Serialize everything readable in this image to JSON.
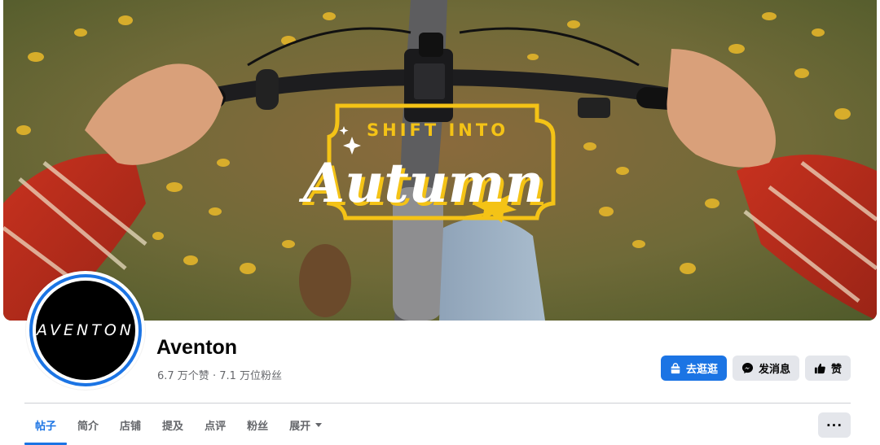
{
  "cover": {
    "kicker": "SHIFT INTO",
    "headline": "Autumn",
    "frame_color": "#f4c316"
  },
  "avatar": {
    "logo_text": "AVENTON",
    "ring_color": "#1b74e4"
  },
  "page": {
    "name": "Aventon",
    "stats": "6.7 万个赞 · 7.1 万位粉丝"
  },
  "actions": {
    "shop": {
      "label": "去逛逛",
      "icon": "shop-bag-icon"
    },
    "message": {
      "label": "发消息",
      "icon": "messenger-icon"
    },
    "like": {
      "label": "赞",
      "icon": "thumbs-up-icon"
    }
  },
  "tabs": [
    {
      "label": "帖子",
      "active": true
    },
    {
      "label": "简介"
    },
    {
      "label": "店铺"
    },
    {
      "label": "提及"
    },
    {
      "label": "点评"
    },
    {
      "label": "粉丝"
    },
    {
      "label": "展开",
      "dropdown": true
    }
  ],
  "more_button": {
    "label": "···",
    "icon": "more-dots-icon"
  },
  "colors": {
    "accent": "#1b74e4",
    "secondary_button": "#e4e6eb",
    "muted_text": "#65676b"
  }
}
